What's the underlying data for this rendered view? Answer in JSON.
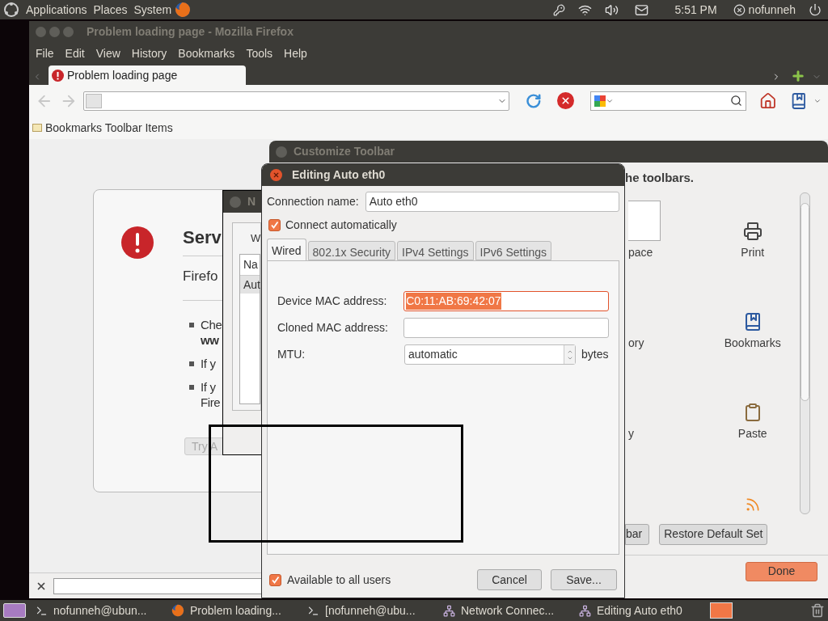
{
  "top_panel": {
    "menus": [
      "Applications",
      "Places",
      "System"
    ],
    "clock": "5:51 PM",
    "user": "nofunneh"
  },
  "firefox": {
    "title": "Problem loading page - Mozilla Firefox",
    "menus": [
      "File",
      "Edit",
      "View",
      "History",
      "Bookmarks",
      "Tools",
      "Help"
    ],
    "tabs": [
      {
        "label": "Problem loading page",
        "selected": true
      }
    ],
    "bookmarks_toolbar": "Bookmarks Toolbar Items",
    "error": {
      "title": "Serv",
      "message": "Firefo",
      "bullets": [
        [
          "Che",
          "ww"
        ],
        [
          "If y"
        ],
        [
          "If y",
          "Fire"
        ]
      ],
      "button": "Try A"
    }
  },
  "network_connections": {
    "title": "N",
    "tab": "W",
    "column": "Na",
    "rows": [
      {
        "label": "Aut",
        "selected": true
      }
    ]
  },
  "customize_toolbar": {
    "title": "Customize Toolbar",
    "instruction": "he toolbars.",
    "items": [
      {
        "kind": "space",
        "label": "pace"
      },
      {
        "kind": "print",
        "label": "Print"
      },
      {
        "kind": "partial",
        "label": "ory"
      },
      {
        "kind": "bookmarks",
        "label": "Bookmarks"
      },
      {
        "kind": "partial",
        "label": "y"
      },
      {
        "kind": "paste",
        "label": "Paste"
      },
      {
        "kind": "none"
      },
      {
        "kind": "feed"
      }
    ],
    "buttons": [
      "bar",
      "Restore Default Set"
    ],
    "done": "Done"
  },
  "edit_dialog": {
    "title": "Editing Auto eth0",
    "connection_name_label": "Connection name:",
    "connection_name": "Auto eth0",
    "connect_automatically": {
      "label": "Connect automatically",
      "checked": true
    },
    "tabs": [
      {
        "label": "Wired",
        "selected": true
      },
      {
        "label": "802.1x Security",
        "selected": false
      },
      {
        "label": "IPv4 Settings",
        "selected": false
      },
      {
        "label": "IPv6 Settings",
        "selected": false
      }
    ],
    "fields": [
      {
        "kind": "text",
        "label": "Device MAC address:",
        "value": "C0:11:AB:69:42:07",
        "selected": true
      },
      {
        "kind": "text",
        "label": "Cloned MAC address:",
        "selected": false
      },
      {
        "kind": "spin",
        "label": "MTU:",
        "value": "automatic",
        "unit": "bytes",
        "selected": false
      }
    ],
    "available_to_all": {
      "label": "Available to all users",
      "checked": true
    },
    "buttons": [
      "Cancel",
      "Save..."
    ]
  },
  "taskbar": [
    {
      "kind": "terminal",
      "label": "nofunneh@ubun..."
    },
    {
      "kind": "firefox",
      "label": "Problem loading..."
    },
    {
      "kind": "terminal",
      "label": "[nofunneh@ubu..."
    },
    {
      "kind": "network",
      "label": "Network Connec..."
    },
    {
      "kind": "network",
      "label": "Editing Auto eth0"
    }
  ]
}
